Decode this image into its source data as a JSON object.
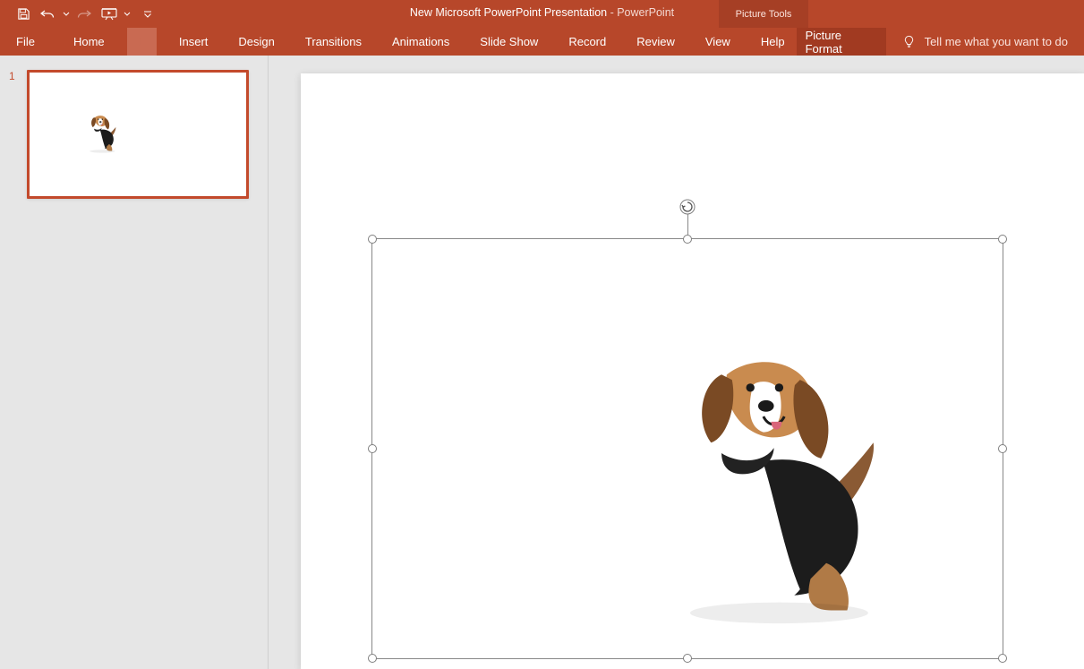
{
  "qat": {
    "save": "Save",
    "undo": "Undo",
    "redo": "Redo",
    "start_from_beginning": "Start From Beginning",
    "customize": "Customize Quick Access Toolbar"
  },
  "title": {
    "doc": "New Microsoft PowerPoint Presentation",
    "sep": "  -  ",
    "app": "PowerPoint"
  },
  "context_tab_group": "Picture Tools",
  "tabs": {
    "file": "File",
    "home": "Home",
    "hidden": "1",
    "insert": "Insert",
    "design": "Design",
    "transitions": "Transitions",
    "animations": "Animations",
    "slide_show": "Slide Show",
    "record": "Record",
    "review": "Review",
    "view": "View",
    "help": "Help",
    "picture_format": "Picture Format"
  },
  "tell_me": {
    "placeholder": "Tell me what you want to do"
  },
  "thumbnails": {
    "slide1_number": "1"
  },
  "selection": {
    "object": "Picture"
  }
}
